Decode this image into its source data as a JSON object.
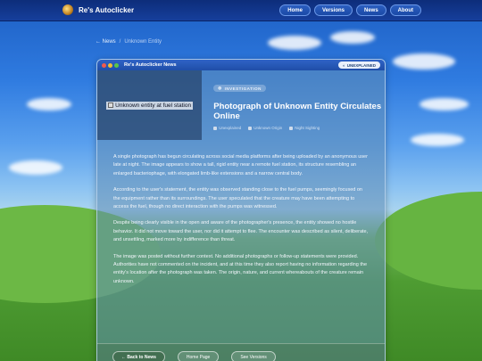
{
  "app": {
    "brand": "Re's Autoclicker"
  },
  "nav": {
    "items": [
      "Home",
      "Versions",
      "News",
      "About"
    ]
  },
  "breadcrumb": {
    "back": "← News",
    "separator": "/",
    "current": "Unknown Entity"
  },
  "window": {
    "title": "Re's Autoclicker News",
    "badge": "UNEXPLAINED"
  },
  "article": {
    "image_alt": "Unknown entity at fuel station",
    "tag": "INVESTIGATION",
    "headline": "Photograph of Unknown Entity Circulates Online",
    "meta": [
      "Unexplained",
      "Unknown Origin",
      "Night Sighting"
    ],
    "paragraphs": [
      "A single photograph has begun circulating across social media platforms after being uploaded by an anonymous user late at night. The image appears to show a tall, rigid entity near a remote fuel station, its structure resembling an enlarged bacteriophage, with elongated limb-like extensions and a narrow central body.",
      "According to the user's statement, the entity was observed standing close to the fuel pumps, seemingly focused on the equipment rather than its surroundings. The user speculated that the creature may have been attempting to access the fuel, though no direct interaction with the pumps was witnessed.",
      "Despite being clearly visible in the open and aware of the photographer's presence, the entity showed no hostile behavior. It did not move toward the user, nor did it attempt to flee. The encounter was described as silent, deliberate, and unsettling, marked more by indifference than threat.",
      "The image was posted without further context. No additional photographs or follow-up statements were provided. Authorities have not commented on the incident, and at this time they also report having no information regarding the entity's location after the photograph was taken. The origin, nature, and current whereabouts of the creature remain unknown."
    ]
  },
  "footer": {
    "back": "← Back to News",
    "home": "Home Page",
    "versions": "See Versions"
  }
}
